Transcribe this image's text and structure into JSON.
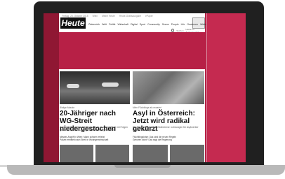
{
  "site": {
    "logo_text": "Heute",
    "top_bar": [
      "Freitag, 23. Oktober 2015",
      "Wien",
      "Meine Heute",
      "Heute-Gratisausgabe",
      "ePaper"
    ],
    "nav": [
      "Österreich",
      "Welt",
      "Politik",
      "Wirtschaft",
      "Digital",
      "Sport",
      "Community",
      "Szene",
      "People",
      "Life",
      "Gewinnen",
      "Wetter",
      "TV"
    ],
    "search": {
      "label": "Suchen",
      "extra": "Heute im Zeitungsarchiv"
    }
  },
  "articles": [
    {
      "kicker": "Blutige Attacke",
      "headline": "20-Jähriger nach WG-Streit niedergestochen",
      "body": "In einer WG in Wien-Brigittenau ist es zu einem Streit mit Folgen gekommen: Ein 20-Jähriger wurde niedergestochen.",
      "links": [
        "Messer-Angriff in Wien: Mann schwer verletzt",
        "Polizei ermittelt nach Streit in Wohngemeinschaft"
      ]
    },
    {
      "kicker": "Mehr Flüchtlinge als erwartet",
      "headline": "Asyl in Österreich: Jetzt wird radikal gekürzt",
      "body": "Die Regierung zieht die Notbremse: Leistungen für Asylwerber werden massiv gekürzt.",
      "links": [
        "Flüchtlingskrise: Das sind die neuen Regeln",
        "Grenzen dicht? Das sagt die Regierung"
      ]
    }
  ],
  "colors": {
    "accent": "#b72046",
    "accent_dark": "#8f1733"
  }
}
